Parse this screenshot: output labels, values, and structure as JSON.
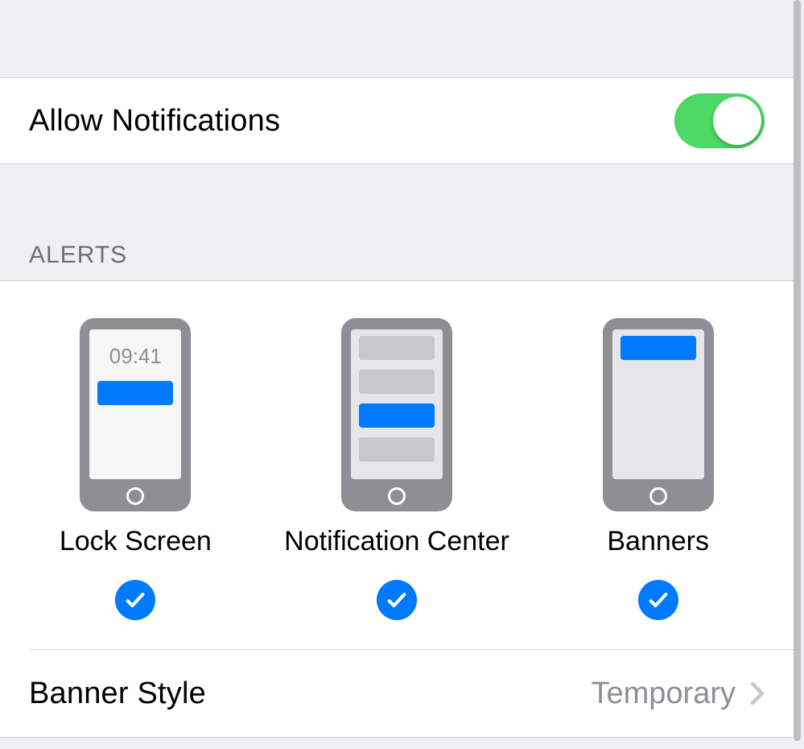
{
  "allow_notifications": {
    "label": "Allow Notifications",
    "enabled": true
  },
  "alerts": {
    "header": "ALERTS",
    "lock_screen_time": "09:41",
    "options": [
      {
        "label": "Lock Screen",
        "checked": true
      },
      {
        "label": "Notification Center",
        "checked": true
      },
      {
        "label": "Banners",
        "checked": true
      }
    ]
  },
  "banner_style": {
    "label": "Banner Style",
    "value": "Temporary"
  },
  "colors": {
    "accent": "#007aff",
    "toggle_on": "#4cd964",
    "group_bg": "#efeff4"
  }
}
